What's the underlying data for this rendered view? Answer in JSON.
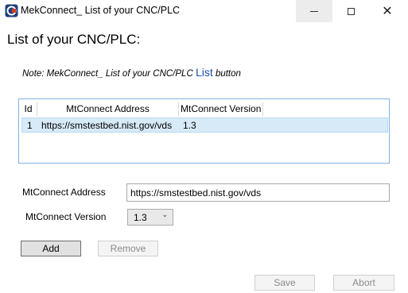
{
  "window": {
    "title": "MekConnect_ List of your CNC/PLC",
    "icon": "app-icon"
  },
  "heading": "List of your CNC/PLC:",
  "note": {
    "prefix": "Note: MekConnect_ List of your CNC/PLC ",
    "link": "List",
    "suffix": " button"
  },
  "list": {
    "columns": [
      "Id",
      "MtConnect Address",
      "MtConnect Version"
    ],
    "rows": [
      {
        "id": "1",
        "address": "https://smstestbed.nist.gov/vds",
        "version": "1.3"
      }
    ]
  },
  "form": {
    "address_label": "MtConnect Address",
    "address_value": "https://smstestbed.nist.gov/vds",
    "version_label": "MtConnect Version",
    "version_value": "1.3"
  },
  "buttons": {
    "add": "Add",
    "remove": "Remove",
    "save": "Save",
    "abort": "Abort"
  },
  "colors": {
    "selection": "#d7eaf8",
    "list_border": "#7fb2e5",
    "link": "#1a52b0"
  }
}
